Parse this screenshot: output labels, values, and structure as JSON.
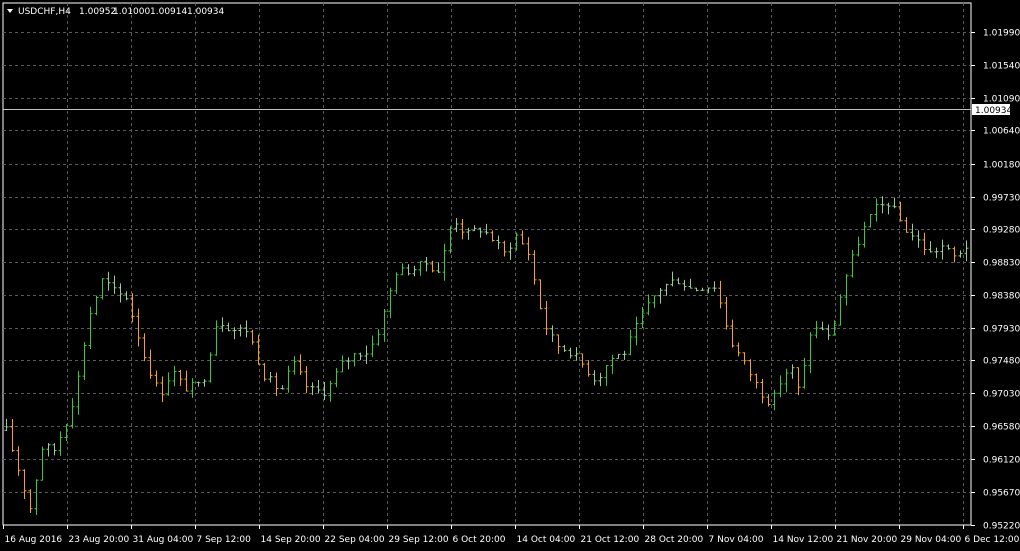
{
  "header": {
    "symbol": "USDCHF,H4",
    "open": "1.00952",
    "high": "1.01000",
    "low": "1.00914",
    "close": "1.00934"
  },
  "chart_data": {
    "type": "bar",
    "title": "USDCHF,H4",
    "ylim": [
      0.9522,
      1.021
    ],
    "y_ticks": [
      "1.01990",
      "1.01540",
      "1.01090",
      "1.00640",
      "1.00180",
      "0.99730",
      "0.99280",
      "0.98830",
      "0.98380",
      "0.97930",
      "0.97480",
      "0.97030",
      "0.96580",
      "0.96120",
      "0.95670",
      "0.95220"
    ],
    "x_ticks": [
      "16 Aug 2016",
      "23 Aug 20:00",
      "31 Aug 04:00",
      "7 Sep 12:00",
      "14 Sep 20:00",
      "22 Sep 04:00",
      "29 Sep 12:00",
      "6 Oct 20:00",
      "14 Oct 04:00",
      "21 Oct 12:00",
      "28 Oct 20:00",
      "7 Nov 04:00",
      "14 Nov 12:00",
      "21 Nov 20:00",
      "29 Nov 04:00",
      "6 Dec 12:00"
    ],
    "grid": true,
    "current_price": 1.00934,
    "colors": {
      "bull": "#33cc33",
      "bear": "#ffa500",
      "ohlc": "#90d090",
      "background": "#000000",
      "grid": "#5a5a5a"
    },
    "path": [
      [
        0,
        0.9652
      ],
      [
        10,
        0.9585
      ],
      [
        16,
        0.9545
      ],
      [
        24,
        0.963
      ],
      [
        32,
        0.9625
      ],
      [
        40,
        0.9665
      ],
      [
        46,
        0.9705
      ],
      [
        55,
        0.981
      ],
      [
        64,
        0.986
      ],
      [
        73,
        0.984
      ],
      [
        80,
        0.9835
      ],
      [
        92,
        0.975
      ],
      [
        102,
        0.97
      ],
      [
        110,
        0.9735
      ],
      [
        118,
        0.971
      ],
      [
        130,
        0.9715
      ],
      [
        140,
        0.9805
      ],
      [
        150,
        0.979
      ],
      [
        160,
        0.979
      ],
      [
        170,
        0.973
      ],
      [
        182,
        0.9705
      ],
      [
        190,
        0.9745
      ],
      [
        200,
        0.9708
      ],
      [
        212,
        0.9705
      ],
      [
        222,
        0.9742
      ],
      [
        232,
        0.9758
      ],
      [
        240,
        0.976
      ],
      [
        248,
        0.9795
      ],
      [
        258,
        0.987
      ],
      [
        268,
        0.9872
      ],
      [
        278,
        0.9882
      ],
      [
        287,
        0.987
      ],
      [
        296,
        0.9945
      ],
      [
        305,
        0.992
      ],
      [
        313,
        0.993
      ],
      [
        320,
        0.992
      ],
      [
        330,
        0.9895
      ],
      [
        338,
        0.992
      ],
      [
        346,
        0.9895
      ],
      [
        356,
        0.98
      ],
      [
        364,
        0.977
      ],
      [
        374,
        0.976
      ],
      [
        383,
        0.974
      ],
      [
        391,
        0.972
      ],
      [
        400,
        0.975
      ],
      [
        410,
        0.976
      ],
      [
        420,
        0.9805
      ],
      [
        432,
        0.9845
      ],
      [
        444,
        0.986
      ],
      [
        455,
        0.9845
      ],
      [
        462,
        0.985
      ],
      [
        470,
        0.985
      ],
      [
        480,
        0.9775
      ],
      [
        490,
        0.974
      ],
      [
        500,
        0.9705
      ],
      [
        507,
        0.9688
      ],
      [
        514,
        0.9725
      ],
      [
        520,
        0.974
      ],
      [
        526,
        0.97
      ],
      [
        532,
        0.9785
      ],
      [
        540,
        0.9795
      ],
      [
        546,
        0.9775
      ],
      [
        554,
        0.985
      ],
      [
        566,
        0.992
      ],
      [
        575,
        0.9955
      ],
      [
        585,
        0.9965
      ],
      [
        595,
        0.993
      ],
      [
        605,
        0.991
      ],
      [
        612,
        0.9895
      ],
      [
        620,
        0.9905
      ],
      [
        628,
        0.989
      ],
      [
        636,
        0.9905
      ]
    ]
  }
}
